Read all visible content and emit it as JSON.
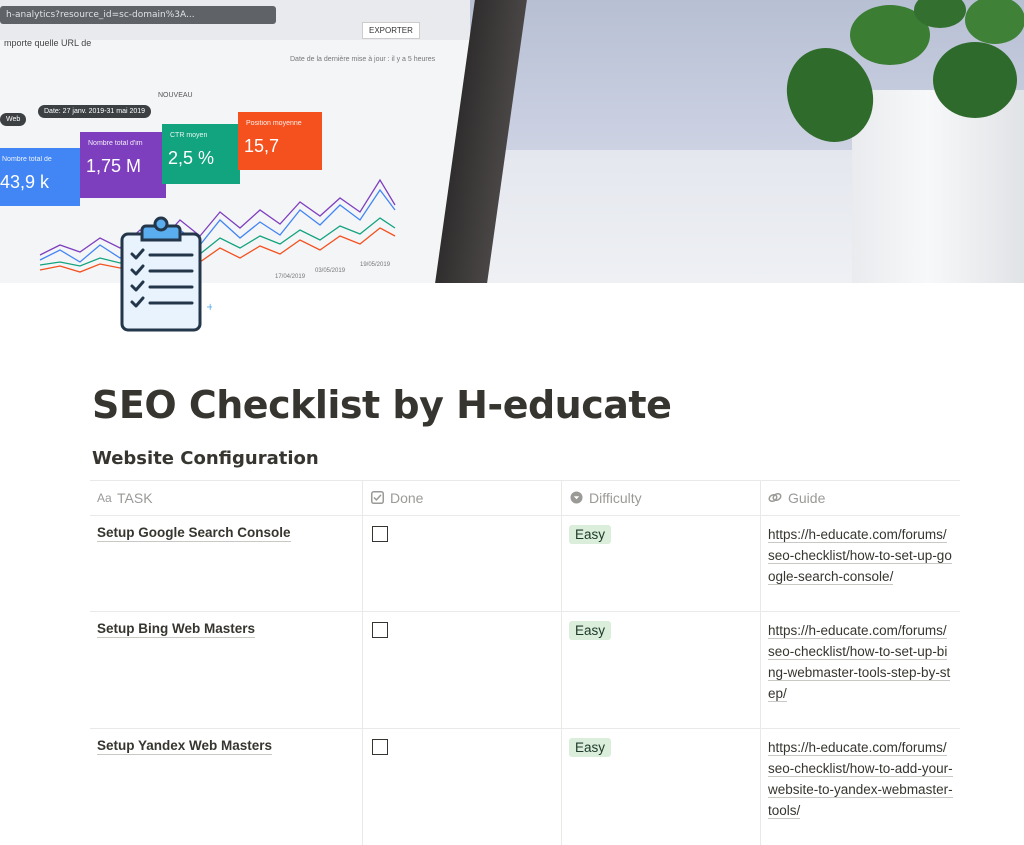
{
  "cover": {
    "url_text": "h-analytics?resource_id=sc-domain%3A...",
    "filter_text": "mporte quelle URL de",
    "export_label": "EXPORTER",
    "date_note": "Date de la dernière mise à jour : il y a 5 heures",
    "chip_web": "Web",
    "chip_date": "Date: 27 janv. 2019-31 mai 2019",
    "nouveau": "NOUVEAU",
    "cards": [
      {
        "label": "Nombre total de",
        "value": "43,9 k",
        "color": "#4285f4"
      },
      {
        "label": "Nombre total d'im",
        "value": "1,75 M",
        "color": "#7e3fbf"
      },
      {
        "label": "CTR moyen",
        "value": "2,5 %",
        "color": "#12a37f"
      },
      {
        "label": "Position moyenne",
        "value": "15,7",
        "color": "#f4511e"
      }
    ],
    "chart_dates": [
      "17/04/2019",
      "03/05/2019",
      "19/05/2019"
    ]
  },
  "page_icon": "clipboard-checklist-icon",
  "title": "SEO Checklist by H-educate",
  "database": {
    "title": "Website Configuration",
    "columns": [
      {
        "label": "TASK",
        "icon": "text-property-icon"
      },
      {
        "label": "Done",
        "icon": "checkbox-property-icon"
      },
      {
        "label": "Difficulty",
        "icon": "select-property-icon"
      },
      {
        "label": "Guide",
        "icon": "url-property-icon"
      }
    ],
    "rows": [
      {
        "task": "Setup Google Search Console",
        "done": false,
        "difficulty": "Easy",
        "guide": "https://h-educate.com/forums/seo-checklist/how-to-set-up-google-search-console/"
      },
      {
        "task": "Setup Bing Web Masters",
        "done": false,
        "difficulty": "Easy",
        "guide": "https://h-educate.com/forums/seo-checklist/how-to-set-up-bing-webmaster-tools-step-by-step/"
      },
      {
        "task": "Setup Yandex Web Masters",
        "done": false,
        "difficulty": "Easy",
        "guide": "https://h-educate.com/forums/seo-checklist/how-to-add-your-website-to-yandex-webmaster-tools/"
      }
    ]
  },
  "colors": {
    "tag_easy_bg": "#dbeddb",
    "text": "#37352f",
    "muted": "#9b9a97"
  }
}
